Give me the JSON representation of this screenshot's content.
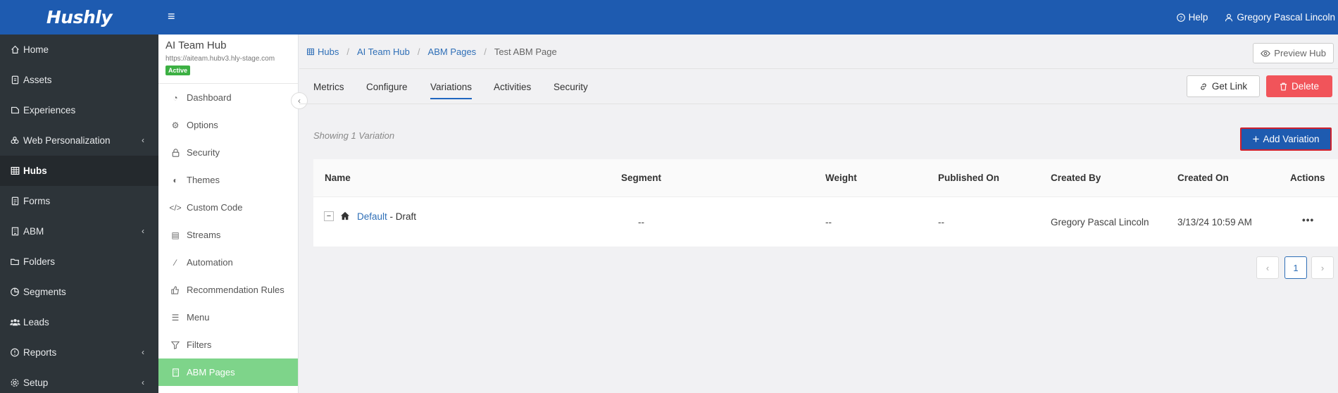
{
  "brand": {
    "name": "Hushly"
  },
  "topbar": {
    "help_label": "Help",
    "user_name": "Gregory Pascal Lincoln"
  },
  "sidebar": {
    "items": [
      {
        "label": "Home",
        "icon": "home-icon"
      },
      {
        "label": "Assets",
        "icon": "assets-icon"
      },
      {
        "label": "Experiences",
        "icon": "experiences-icon"
      },
      {
        "label": "Web Personalization",
        "icon": "web-personalization-icon",
        "has_chevron": true
      },
      {
        "label": "Hubs",
        "icon": "hubs-icon",
        "active": true
      },
      {
        "label": "Forms",
        "icon": "forms-icon"
      },
      {
        "label": "ABM",
        "icon": "abm-icon",
        "has_chevron": true
      },
      {
        "label": "Folders",
        "icon": "folders-icon"
      },
      {
        "label": "Segments",
        "icon": "segments-icon"
      },
      {
        "label": "Leads",
        "icon": "leads-icon"
      },
      {
        "label": "Reports",
        "icon": "reports-icon",
        "has_chevron": true
      },
      {
        "label": "Setup",
        "icon": "setup-icon",
        "has_chevron": true
      }
    ]
  },
  "hub": {
    "title": "AI Team Hub",
    "url": "https://aiteam.hubv3.hly-stage.com",
    "status": "Active",
    "status_color": "#3cb043",
    "items": [
      {
        "label": "Dashboard",
        "icon": "dashboard-icon"
      },
      {
        "label": "Options",
        "icon": "options-icon"
      },
      {
        "label": "Security",
        "icon": "lock-icon"
      },
      {
        "label": "Themes",
        "icon": "palette-icon"
      },
      {
        "label": "Custom Code",
        "icon": "code-icon"
      },
      {
        "label": "Streams",
        "icon": "streams-icon"
      },
      {
        "label": "Automation",
        "icon": "automation-icon"
      },
      {
        "label": "Recommendation Rules",
        "icon": "thumbs-up-icon"
      },
      {
        "label": "Menu",
        "icon": "menu-icon"
      },
      {
        "label": "Filters",
        "icon": "filter-icon"
      },
      {
        "label": "ABM Pages",
        "icon": "abm-pages-icon",
        "active": true
      }
    ]
  },
  "breadcrumb": {
    "items": [
      "Hubs",
      "AI Team Hub",
      "ABM Pages"
    ],
    "current": "Test ABM Page"
  },
  "preview_label": "Preview Hub",
  "tabs": [
    {
      "label": "Metrics"
    },
    {
      "label": "Configure"
    },
    {
      "label": "Variations",
      "active": true
    },
    {
      "label": "Activities"
    },
    {
      "label": "Security"
    }
  ],
  "actions": {
    "get_link": "Get Link",
    "delete": "Delete",
    "add_variation": "Add Variation"
  },
  "colors": {
    "brand": "#1e5bb0",
    "delete": "#f1545a",
    "accent_link": "#2f6fb7",
    "highlight_border": "#d0202c"
  },
  "showing_text": "Showing 1 Variation",
  "table": {
    "columns": [
      "Name",
      "Segment",
      "Weight",
      "Published On",
      "Created By",
      "Created On",
      "Actions"
    ],
    "rows": [
      {
        "name": "Default",
        "state": " - Draft",
        "segment": "--",
        "weight": "--",
        "published_on": "--",
        "created_by": "Gregory Pascal Lincoln",
        "created_on": "3/13/24 10:59 AM",
        "actions": "•••"
      }
    ]
  },
  "pagination": {
    "prev": "‹",
    "current": "1",
    "next": "›"
  }
}
